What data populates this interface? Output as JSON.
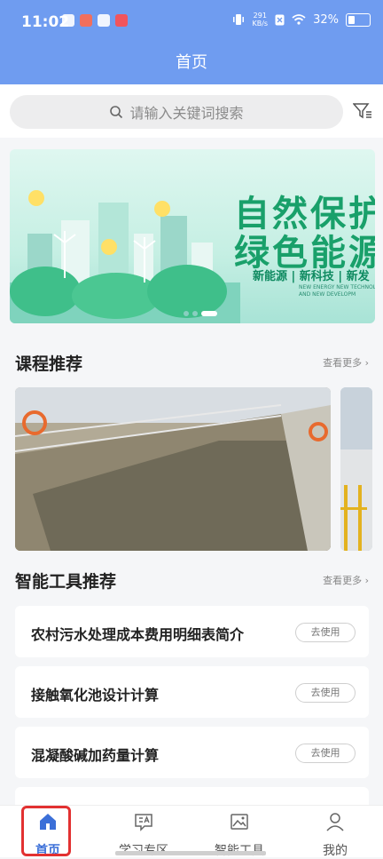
{
  "status_bar": {
    "time": "11:02",
    "net_speed_value": "291",
    "net_speed_unit": "KB/s",
    "battery": "32%"
  },
  "header": {
    "title": "首页"
  },
  "search": {
    "placeholder": "请输入关键词搜索"
  },
  "banner": {
    "title_line1": "自然保护",
    "title_line2": "绿色能源",
    "subtitle": "新能源 | 新科技 | 新发",
    "english_line1": "NEW ENERGY NEW TECHNOLO",
    "english_line2": "AND NEW DEVELOPM"
  },
  "courses": {
    "title": "课程推荐",
    "more": "查看更多 ›"
  },
  "tools": {
    "title": "智能工具推荐",
    "more": "查看更多 ›",
    "items": [
      {
        "label": "农村污水处理成本费用明细表简介",
        "button": "去使用"
      },
      {
        "label": "接触氧化池设计计算",
        "button": "去使用"
      },
      {
        "label": "混凝酸碱加药量计算",
        "button": "去使用"
      },
      {
        "label": "",
        "button": ""
      }
    ]
  },
  "tabbar": {
    "items": [
      {
        "label": "首页",
        "icon": "home-icon"
      },
      {
        "label": "学习专区",
        "icon": "study-icon"
      },
      {
        "label": "智能工具",
        "icon": "image-icon"
      },
      {
        "label": "我的",
        "icon": "user-icon"
      }
    ]
  },
  "colors": {
    "primary": "#6f9cf0",
    "active_tab": "#3b6fd8",
    "banner_green": "#19a06a",
    "highlight": "#e23131"
  }
}
